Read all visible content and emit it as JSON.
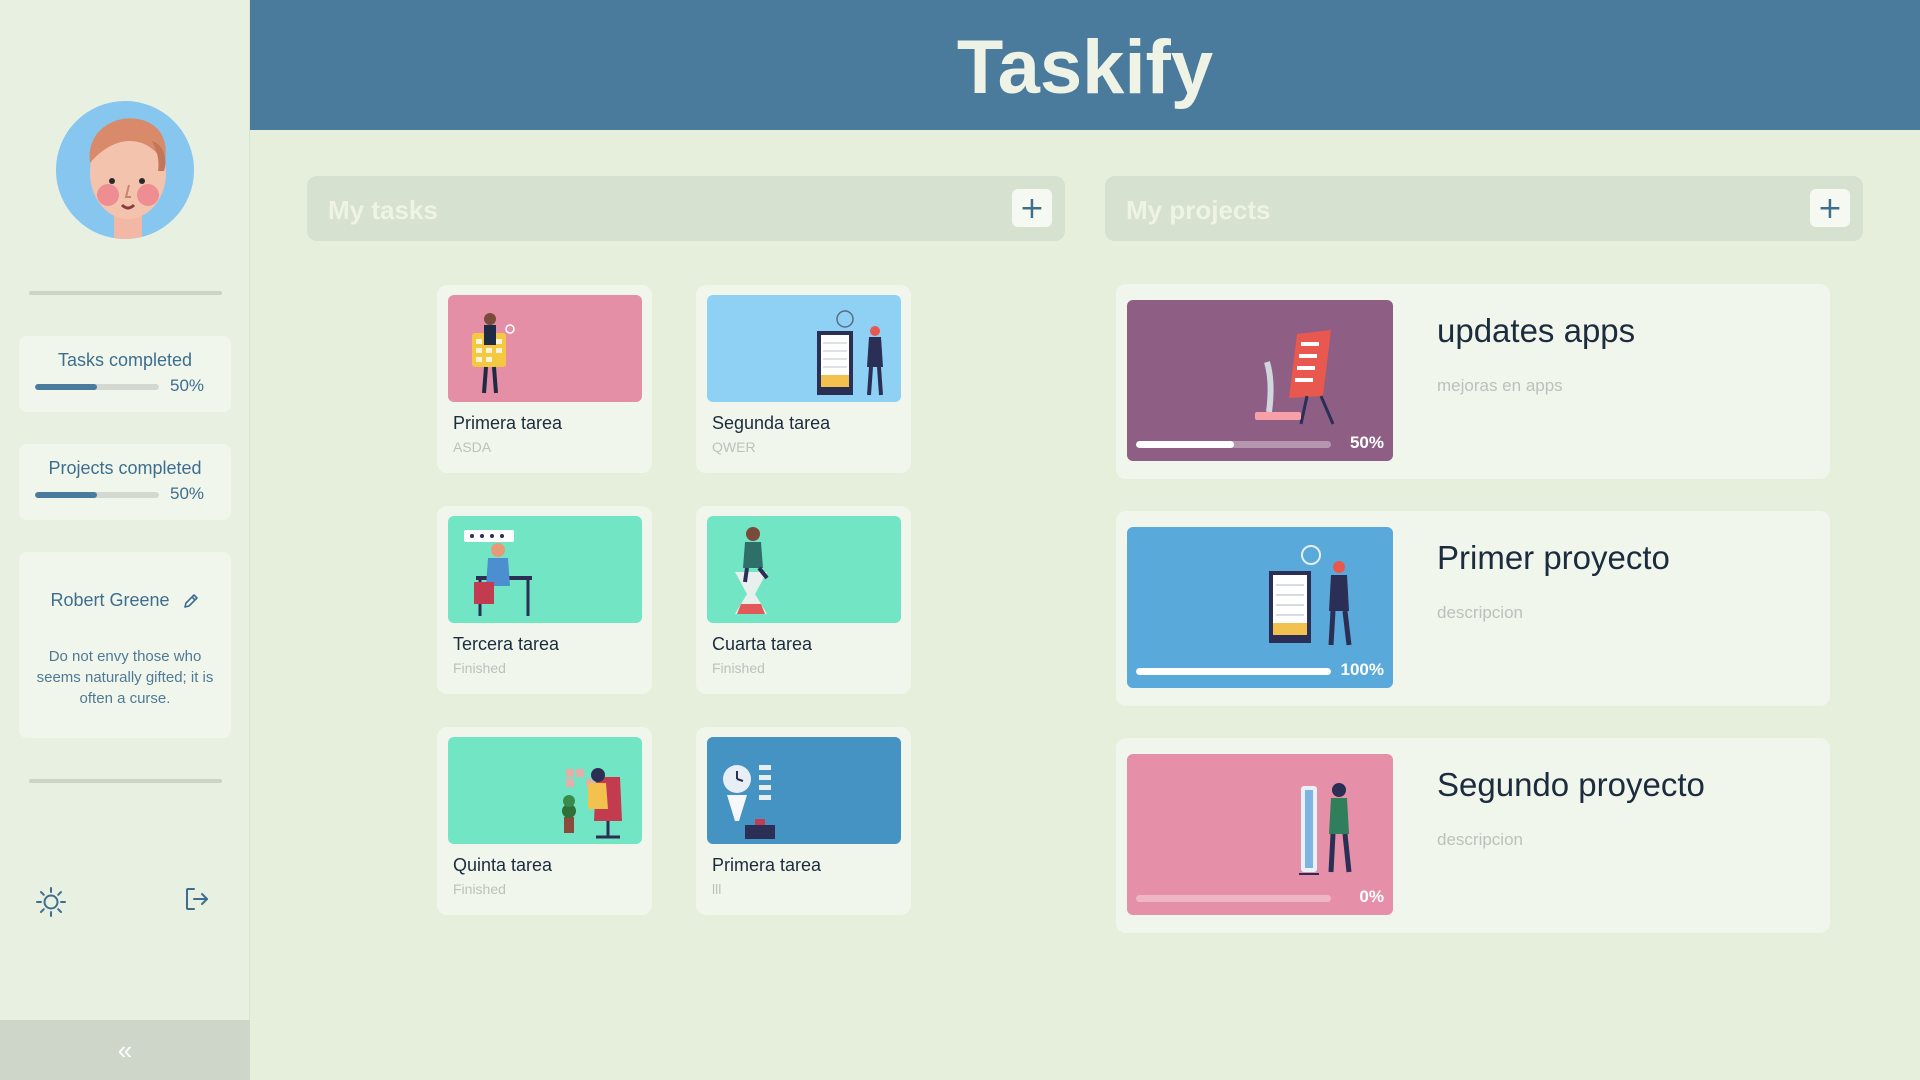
{
  "app": {
    "title": "Taskify"
  },
  "sidebar": {
    "stats": [
      {
        "label": "Tasks completed",
        "percent_text": "50%",
        "progress": 0.5
      },
      {
        "label": "Projects completed",
        "percent_text": "50%",
        "progress": 0.5
      }
    ],
    "profile": {
      "name": "Robert Greene",
      "quote": "Do not envy those who seems naturally gifted; it is often a curse."
    },
    "collapse_label": "«"
  },
  "tasks": {
    "title": "My tasks",
    "add_label": "+",
    "items": [
      {
        "title": "Primera tarea",
        "subtitle": "ASDA",
        "color": "#e58fa7",
        "illustration": "calendar-person-illustration"
      },
      {
        "title": "Segunda tarea",
        "subtitle": "QWER",
        "color": "#8fd0f5",
        "illustration": "board-person-illustration"
      },
      {
        "title": "Tercera tarea",
        "subtitle": "Finished",
        "color": "#72e6c4",
        "illustration": "desk-worker-illustration"
      },
      {
        "title": "Cuarta tarea",
        "subtitle": "Finished",
        "color": "#72e6c4",
        "illustration": "hourglass-person-illustration"
      },
      {
        "title": "Quinta tarea",
        "subtitle": "Finished",
        "color": "#72e6c4",
        "illustration": "chair-worker-illustration"
      },
      {
        "title": "Primera tarea",
        "subtitle": "lll",
        "color": "#4493c2",
        "illustration": "clock-hourglass-illustration"
      }
    ]
  },
  "projects": {
    "title": "My projects",
    "add_label": "+",
    "items": [
      {
        "title": "updates apps",
        "description": "mejoras en apps",
        "percent_text": "50%",
        "progress": 0.5,
        "color": "#8e5e84",
        "illustration": "checklist-easel-illustration"
      },
      {
        "title": "Primer proyecto",
        "description": "descripcion",
        "percent_text": "100%",
        "progress": 1.0,
        "color": "#5aa9db",
        "illustration": "board-person-illustration"
      },
      {
        "title": "Segundo proyecto",
        "description": "descripcion",
        "percent_text": "0%",
        "progress": 0.0,
        "color": "#e68fa8",
        "illustration": "mirror-person-illustration"
      }
    ]
  }
}
